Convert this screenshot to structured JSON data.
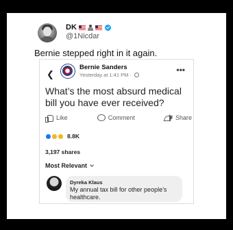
{
  "tweet": {
    "display_name": "DK",
    "handle": "@1Nicdar",
    "text": "Bernie stepped right in it again."
  },
  "post": {
    "back_icon": "chevron-left-icon",
    "author": "Bernie Sanders",
    "time": "Yesterday at 1:41 PM ·",
    "more_icon": "more-horizontal-icon",
    "more_label": "•••",
    "question": "What’s the most absurd medical bill you have ever received?",
    "actions": {
      "like": "Like",
      "comment": "Comment",
      "share": "Share"
    },
    "reactions_count": "8.8K",
    "shares": "3,197 shares",
    "sort_label": "Most Relevant"
  },
  "comment": {
    "author": "Dyreka Klaus",
    "text": "My annual tax bill for other people’s healthcare."
  }
}
